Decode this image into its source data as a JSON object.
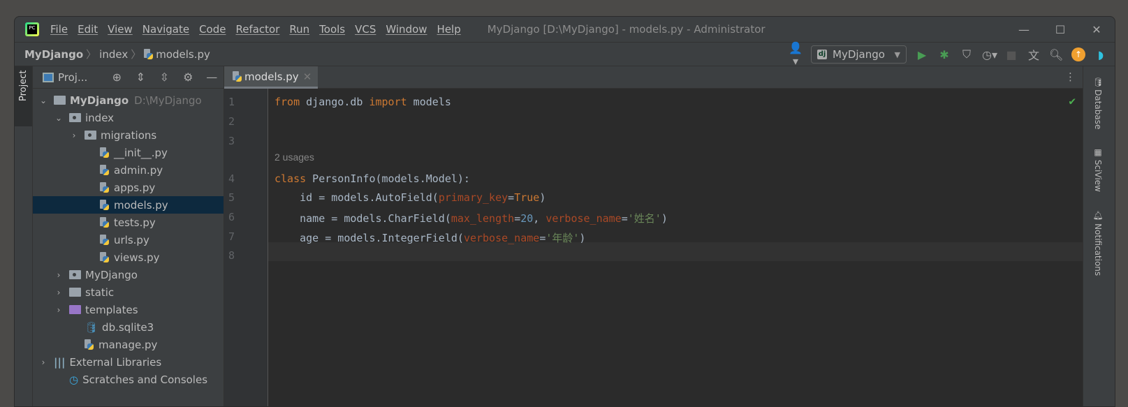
{
  "window": {
    "title": "MyDjango [D:\\MyDjango] - models.py - Administrator",
    "logo": "PC",
    "controls": [
      "minimize-icon",
      "maximize-icon",
      "close-icon"
    ]
  },
  "menu": [
    "File",
    "Edit",
    "View",
    "Navigate",
    "Code",
    "Refactor",
    "Run",
    "Tools",
    "VCS",
    "Window",
    "Help"
  ],
  "breadcrumb": [
    "MyDjango",
    "index",
    "models.py"
  ],
  "toolbar": {
    "run_config": "MyDjango",
    "dj": "dj",
    "icons": [
      "user-icon",
      "run-icon",
      "debug-icon",
      "coverage-icon",
      "profile-icon",
      "stop-icon",
      "translate-icon",
      "search-icon",
      "update-icon",
      "jetbrains-icon"
    ]
  },
  "left_strip": {
    "project_tab": "Project"
  },
  "project_panel": {
    "title": "Proj...",
    "tree": [
      {
        "label": "MyDjango",
        "hint": "D:\\MyDjango",
        "type": "folder",
        "level": 0,
        "expanded": true,
        "bold": true
      },
      {
        "label": "index",
        "type": "package",
        "level": 1,
        "expanded": true
      },
      {
        "label": "migrations",
        "type": "package",
        "level": 2,
        "expanded": false
      },
      {
        "label": "__init__.py",
        "type": "python",
        "level": 3
      },
      {
        "label": "admin.py",
        "type": "python",
        "level": 3
      },
      {
        "label": "apps.py",
        "type": "python",
        "level": 3
      },
      {
        "label": "models.py",
        "type": "python",
        "level": 3,
        "selected": true
      },
      {
        "label": "tests.py",
        "type": "python",
        "level": 3
      },
      {
        "label": "urls.py",
        "type": "python",
        "level": 3
      },
      {
        "label": "views.py",
        "type": "python",
        "level": 3
      },
      {
        "label": "MyDjango",
        "type": "package",
        "level": 1,
        "expanded": false
      },
      {
        "label": "static",
        "type": "folder",
        "level": 1,
        "expanded": false
      },
      {
        "label": "templates",
        "type": "templates",
        "level": 1,
        "expanded": false
      },
      {
        "label": "db.sqlite3",
        "type": "database",
        "level": 2
      },
      {
        "label": "manage.py",
        "type": "python",
        "level": 2
      },
      {
        "label": "External Libraries",
        "type": "libraries",
        "level": 0,
        "expanded": false
      },
      {
        "label": "Scratches and Consoles",
        "type": "scratches",
        "level": 1
      }
    ]
  },
  "editor": {
    "tab": "models.py",
    "usages_hint": "2 usages",
    "line_numbers": [
      "1",
      "2",
      "3",
      "4",
      "5",
      "6",
      "7",
      "8"
    ],
    "lines": {
      "l1": [
        "from",
        " django.db ",
        "import",
        " models"
      ],
      "l4": [
        "class",
        " PersonInfo(models.Model):"
      ],
      "l5": [
        "    id = models.AutoField(",
        "primary_key",
        "=",
        "True",
        ")"
      ],
      "l6": [
        "    name = models.CharField(",
        "max_length",
        "=",
        "20",
        ", ",
        "verbose_name",
        "=",
        "'姓名'",
        ")"
      ],
      "l7": [
        "    age = models.IntegerField(",
        "verbose_name",
        "=",
        "'年龄'",
        ")"
      ]
    }
  },
  "right_strip": [
    "Database",
    "SciView",
    "Notifications"
  ],
  "colors": {
    "keyword": "#cc7832",
    "param": "#aa4926",
    "number": "#6897bb",
    "string": "#6a8759",
    "selection": "#0d293e"
  }
}
